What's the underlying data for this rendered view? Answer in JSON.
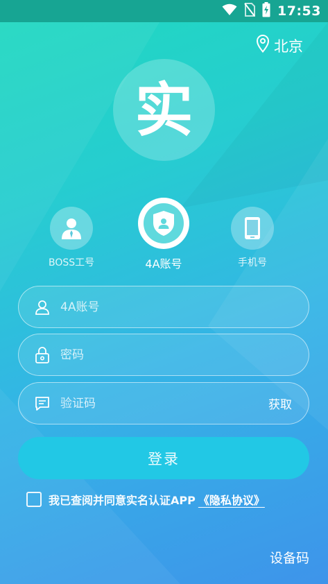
{
  "status_bar": {
    "time": "17:53",
    "icons": [
      "wifi-icon",
      "no-sim-icon",
      "battery-charging-icon"
    ]
  },
  "location": {
    "icon": "location-pin-icon",
    "city": "北京"
  },
  "logo": {
    "char": "实"
  },
  "login_tabs": [
    {
      "label": "BOSS工号",
      "icon": "employee-icon",
      "active": false
    },
    {
      "label": "4A账号",
      "icon": "shield-user-icon",
      "active": true
    },
    {
      "label": "手机号",
      "icon": "phone-icon",
      "active": false
    }
  ],
  "fields": {
    "account": {
      "placeholder": "4A账号",
      "icon": "user-icon"
    },
    "password": {
      "placeholder": "密码",
      "icon": "lock-icon"
    },
    "code": {
      "placeholder": "验证码",
      "icon": "message-icon",
      "action": "获取"
    }
  },
  "login_button": "登录",
  "agreement": {
    "text": "我已查阅并同意实名认证APP",
    "link": "《隐私协议》",
    "checked": false
  },
  "device_code": "设备码",
  "colors": {
    "gradient_top": "#20d9bf",
    "gradient_bottom": "#3e94ea",
    "status_bar": "#17a593",
    "button": "#22c8e5"
  }
}
